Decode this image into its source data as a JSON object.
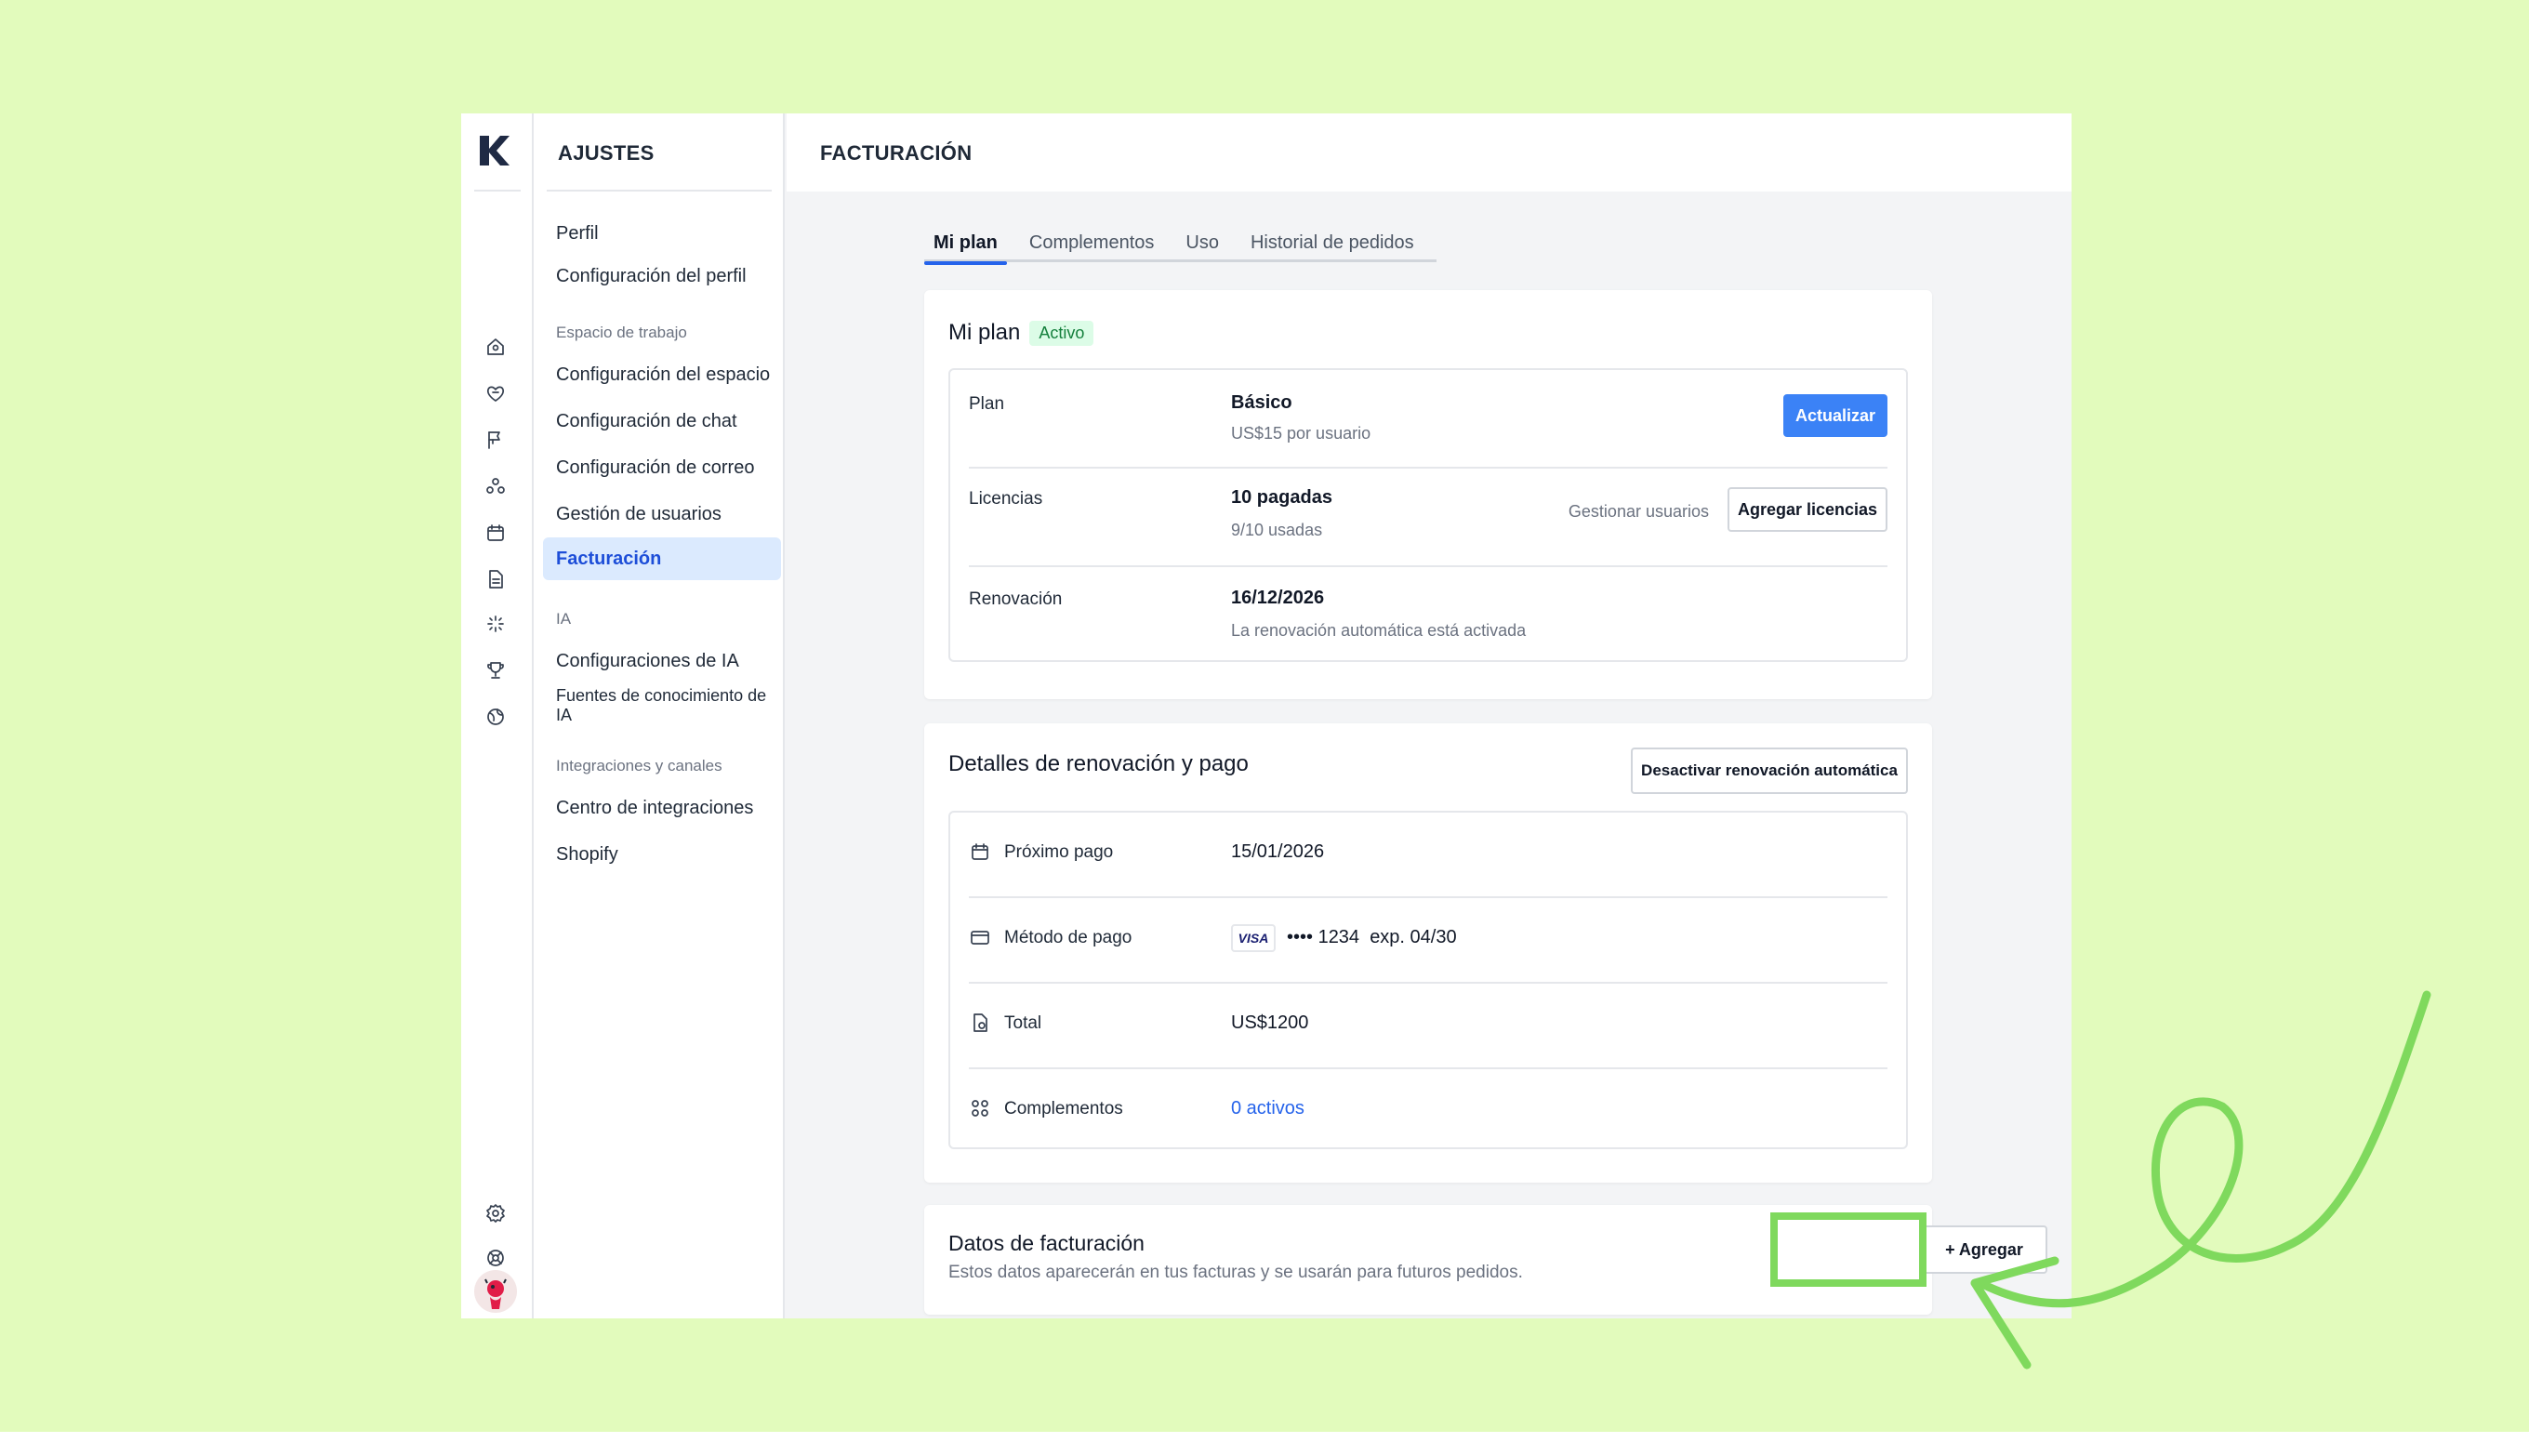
{
  "nav": {
    "title": "AJUSTES",
    "items": [
      {
        "label": "Perfil"
      },
      {
        "label": "Configuración del perfil"
      },
      {
        "label": "Configuración del espacio"
      },
      {
        "label": "Configuración de chat"
      },
      {
        "label": "Configuración de correo"
      },
      {
        "label": "Gestión de usuarios"
      },
      {
        "label": "Facturación"
      },
      {
        "label": "Configuraciones de IA"
      },
      {
        "label": "Fuentes de conocimiento de IA"
      },
      {
        "label": "Centro de integraciones"
      },
      {
        "label": "Shopify"
      }
    ],
    "groups": [
      "Espacio de trabajo",
      "IA",
      "Integraciones y canales"
    ]
  },
  "rail": {
    "top_icons": [
      "home-icon",
      "heart-chat-icon",
      "flag-icon",
      "contacts-icon",
      "calendar-icon",
      "document-icon",
      "sparkle-icon",
      "trophy-icon",
      "globe-icon"
    ],
    "bottom_icons": [
      "gear-icon",
      "help-icon",
      "diamond-icon",
      "bell-icon"
    ]
  },
  "main": {
    "title": "FACTURACIÓN",
    "tabs": [
      {
        "label": "Mi plan"
      },
      {
        "label": "Complementos"
      },
      {
        "label": "Uso"
      },
      {
        "label": "Historial de pedidos"
      }
    ]
  },
  "plan_card": {
    "title": "Mi plan",
    "badge": "Activo",
    "plan_label": "Plan",
    "plan_value": "Básico",
    "plan_sub": "US$15 por usuario",
    "upgrade_button": "Actualizar",
    "licenses_label": "Licencias",
    "licenses_value": "10 pagadas",
    "licenses_sub": "9/10 usadas",
    "manage_users": "Gestionar usuarios",
    "add_licenses_button": "Agregar licencias",
    "renewal_label": "Renovación",
    "renewal_value": "16/12/2026",
    "renewal_sub": "La renovación automática está activada"
  },
  "payment_card": {
    "title": "Detalles de renovación y pago",
    "disable_button": "Desactivar renovación automática",
    "next_payment_label": "Próximo pago",
    "next_payment_value": "15/01/2026",
    "method_label": "Método de pago",
    "card_brand": "VISA",
    "card_number": "•••• 1234",
    "card_exp": "exp. 04/30",
    "total_label": "Total",
    "total_value": "US$1200",
    "addons_label": "Complementos",
    "addons_value": "0 activos"
  },
  "billing_card": {
    "title": "Datos de facturación",
    "subtitle": "Estos datos aparecerán en tus facturas y se usarán para futuros pedidos.",
    "add_button": "+ Agregar"
  },
  "colors": {
    "background": "#e2fbbc",
    "accent": "#3b82f6",
    "highlight": "#7fd95d",
    "active_badge": "#15803d"
  }
}
